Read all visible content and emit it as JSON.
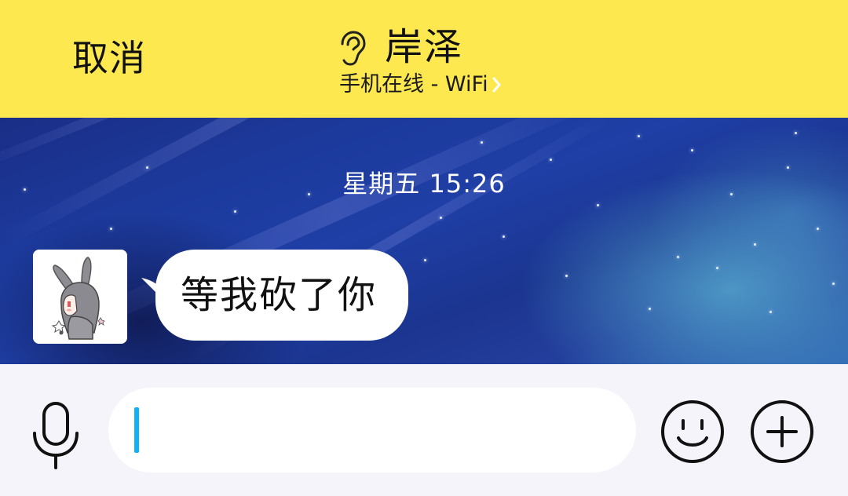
{
  "header": {
    "cancel_label": "取消",
    "contact_name": "岸泽",
    "status": "手机在线 - WiFi",
    "background_color": "#fde84f",
    "icons": [
      "ear-icon",
      "chevron-right-icon"
    ]
  },
  "chat": {
    "timestamp": "星期五 15:26",
    "messages": [
      {
        "sender": "contact",
        "text": "等我砍了你",
        "avatar": "anime-bunny-girl-avatar"
      }
    ]
  },
  "input_bar": {
    "text_value": "",
    "caret_color": "#12b0f4",
    "icons": [
      "microphone-icon",
      "emoji-icon",
      "plus-icon"
    ]
  }
}
